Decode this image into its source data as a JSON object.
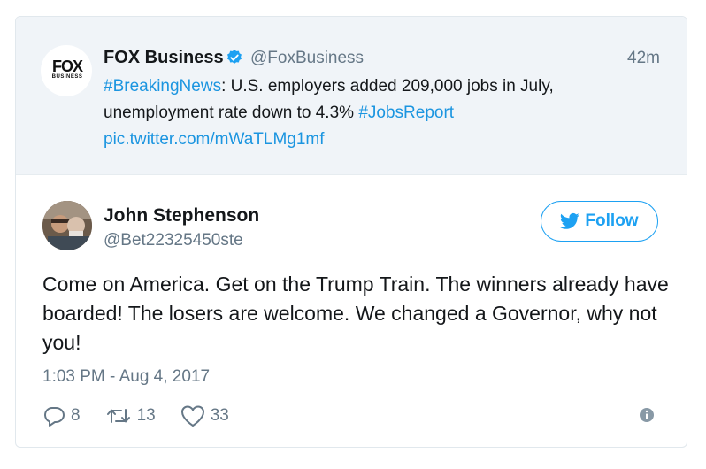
{
  "quoted_tweet": {
    "logo_text": "FOX",
    "logo_subtext": "BUSINESS",
    "name": "FOX Business",
    "handle": "@FoxBusiness",
    "time": "42m",
    "text_hashtag_1": "#BreakingNews",
    "text_body": ": U.S. employers added 209,000 jobs in July, unemployment rate down to 4.3% ",
    "text_hashtag_2": "#JobsReport",
    "text_link": "pic.twitter.com/mWaTLMg1mf"
  },
  "tweet": {
    "name": "John Stephenson",
    "handle": "@Bet22325450ste",
    "follow_label": "Follow",
    "text": "Come on America. Get on the Trump Train. The winners already have boarded! The losers are welcome. We changed a Governor, why not you!",
    "timestamp": "1:03 PM - Aug 4, 2017"
  },
  "actions": {
    "replies": "8",
    "retweets": "13",
    "likes": "33"
  },
  "colors": {
    "accent": "#1da1f2",
    "link": "#1b95e0",
    "secondary_text": "#657786",
    "quoted_bg": "#f0f4f8"
  },
  "icons": {
    "verified": "verified-badge-icon",
    "follow": "twitter-bird-icon",
    "reply": "reply-icon",
    "retweet": "retweet-icon",
    "like": "heart-icon",
    "info": "info-icon"
  }
}
